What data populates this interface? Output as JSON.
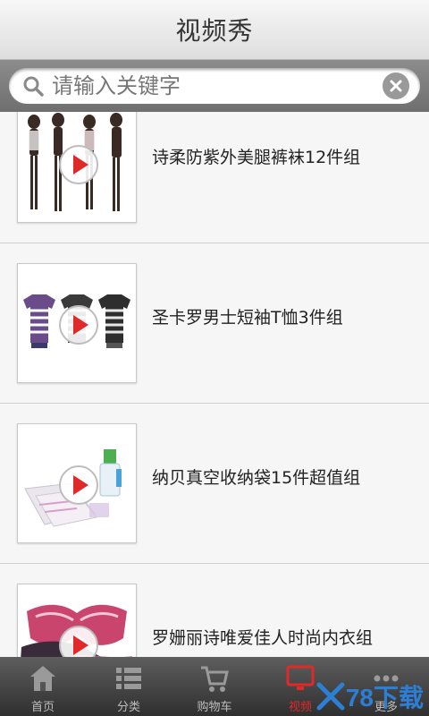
{
  "header": {
    "title": "视频秀"
  },
  "search": {
    "placeholder": "请输入关键字",
    "icon": "search-icon",
    "clear_icon": "clear-icon"
  },
  "items": [
    {
      "title": "诗柔防紫外美腿裤袜12件组"
    },
    {
      "title": "圣卡罗男士短袖T恤3件组"
    },
    {
      "title": "纳贝真空收纳袋15件超值组"
    },
    {
      "title": "罗姗丽诗唯爱佳人时尚内衣组"
    }
  ],
  "tabs": [
    {
      "label": "首页",
      "icon": "home-icon"
    },
    {
      "label": "分类",
      "icon": "list-icon"
    },
    {
      "label": "购物车",
      "icon": "cart-icon"
    },
    {
      "label": "视频",
      "icon": "video-icon"
    },
    {
      "label": "更多",
      "icon": "more-icon"
    }
  ],
  "watermark": {
    "text": "78下载"
  },
  "colors": {
    "accent_red": "#e02a2a",
    "tab_bg": "#3a3a3a",
    "watermark_blue": "#2d7fd6"
  }
}
